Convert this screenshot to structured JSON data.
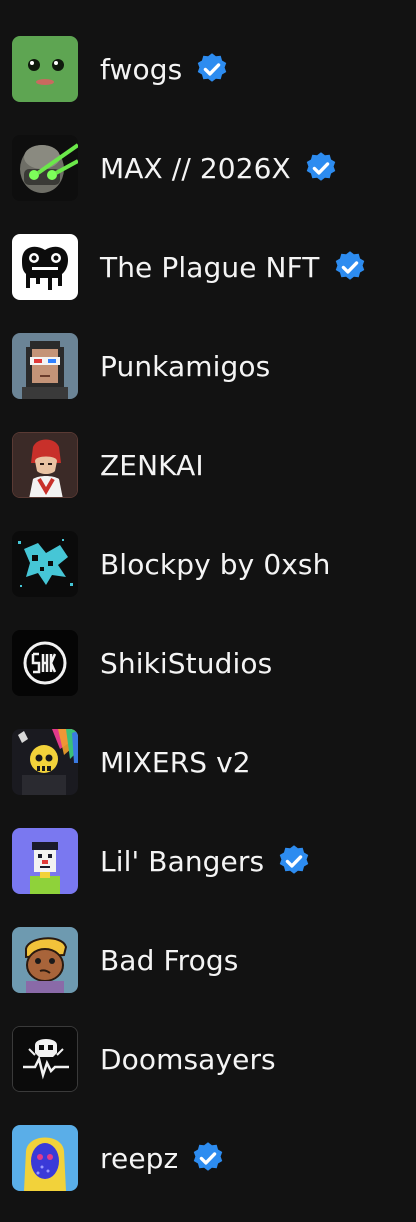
{
  "colors": {
    "background": "#121212",
    "text": "#f4f4f4",
    "verified_badge": "#2d8cf0"
  },
  "collections": [
    {
      "name": "fwogs",
      "verified": true,
      "icon": "frog-face-avatar-icon"
    },
    {
      "name": "MAX // 2026X",
      "verified": true,
      "icon": "robot-head-laser-eyes-avatar-icon"
    },
    {
      "name": "The Plague NFT",
      "verified": true,
      "icon": "dripping-frog-logo-avatar-icon"
    },
    {
      "name": "Punkamigos",
      "verified": false,
      "icon": "pixel-punk-3d-glasses-avatar-icon"
    },
    {
      "name": "ZENKAI",
      "verified": false,
      "icon": "red-hair-anime-character-avatar-icon"
    },
    {
      "name": "Blockpy by 0xsh",
      "verified": false,
      "icon": "cyan-splatter-avatar-icon"
    },
    {
      "name": "ShikiStudios",
      "verified": false,
      "icon": "shiki-logo-avatar-icon"
    },
    {
      "name": "MIXERS v2",
      "verified": false,
      "icon": "yellow-skull-rainbow-avatar-icon"
    },
    {
      "name": "Lil' Bangers",
      "verified": true,
      "icon": "pixel-clown-avatar-icon"
    },
    {
      "name": "Bad Frogs",
      "verified": false,
      "icon": "blonde-cartoon-character-avatar-icon"
    },
    {
      "name": "Doomsayers",
      "verified": false,
      "icon": "skull-heartbeat-avatar-icon"
    },
    {
      "name": "reepz",
      "verified": true,
      "icon": "hooded-blue-face-avatar-icon"
    }
  ]
}
